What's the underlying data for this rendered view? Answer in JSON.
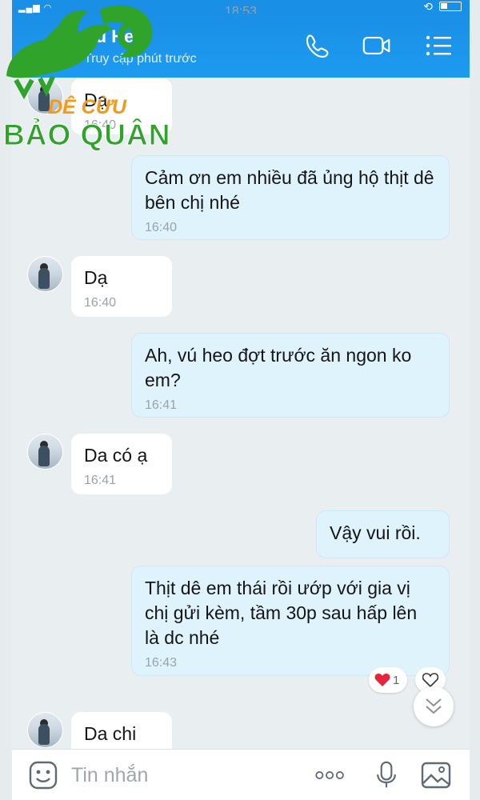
{
  "status": {
    "time": "18:53"
  },
  "header": {
    "name": "Vú Heo",
    "subtitle": "Truy cập phút trước"
  },
  "logo": {
    "line1": "DÊ CỪU",
    "line2": "BẢO QUÂN"
  },
  "messages": [
    {
      "side": "in",
      "text": "Dạ",
      "time": "16:40",
      "note": "partially hidden behind logo"
    },
    {
      "side": "out",
      "text": "Cảm ơn em nhiều đã ủng hộ thịt dê bên chị nhé",
      "time": "16:40"
    },
    {
      "side": "in",
      "text": "Dạ",
      "time": "16:40"
    },
    {
      "side": "out",
      "text": "Ah,  vú heo đợt trước ăn ngon ko em?",
      "time": "16:41"
    },
    {
      "side": "in",
      "text": "Da có ạ",
      "time": "16:41"
    },
    {
      "side": "out",
      "text": "Vậy vui rồi.",
      "time": ""
    },
    {
      "side": "out",
      "text": "Thịt dê em thái rồi ướp với gia vị chị gửi kèm,  tầm 30p sau hấp lên là dc nhé",
      "time": "16:43"
    },
    {
      "side": "in",
      "text": "Da chi",
      "time": ""
    }
  ],
  "reaction": {
    "count": "1"
  },
  "input": {
    "placeholder": "Tin nhắn"
  },
  "colors": {
    "header": "#1d9bf0",
    "outgoing_bubble": "#dff3fc",
    "incoming_bubble": "#ffffff",
    "heart": "#e8243a"
  }
}
